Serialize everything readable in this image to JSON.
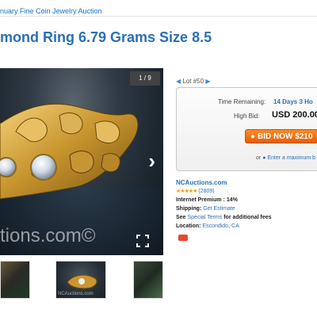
{
  "breadcrumb": "nuary Fine Coin Jewelry Auction",
  "page_title": "mond Ring 6.79 Grams Size 8.5",
  "gallery": {
    "counter": "1 / 9",
    "watermark": "tions.com©",
    "next_icon": "chevron-right-icon",
    "fullscreen_icon": "fullscreen-icon",
    "thumb_watermark": "NCAuctions.com"
  },
  "lot_nav": {
    "prev_icon": "triangle-left-icon",
    "label": "Lot #50",
    "next_icon": "triangle-right-icon"
  },
  "bid_box": {
    "time_remaining_label": "Time Remaining:",
    "time_remaining_value": "14 Days 3 Ho",
    "high_bid_label": "High Bid:",
    "high_bid_value": "USD 200.00",
    "bid_button_label": "BID NOW $210",
    "or_text": "or",
    "max_bid_link": "Enter a maximum b"
  },
  "seller": {
    "name": "NCAuctions.com",
    "stars": "★★★★★",
    "rating_count": "(2809)",
    "premium_label": "Internet Premium :",
    "premium_value": "14%",
    "shipping_label": "Shipping:",
    "shipping_link": "Get Estimate",
    "see_text": "See",
    "special_terms_link": "Special Terms",
    "additional_fees_text": "for additional fees",
    "location_label": "Location:",
    "location_value": "Escondido, CA"
  },
  "colors": {
    "link": "#2a6fb6",
    "bid_button": "#f07018",
    "stars": "#f0a000"
  }
}
